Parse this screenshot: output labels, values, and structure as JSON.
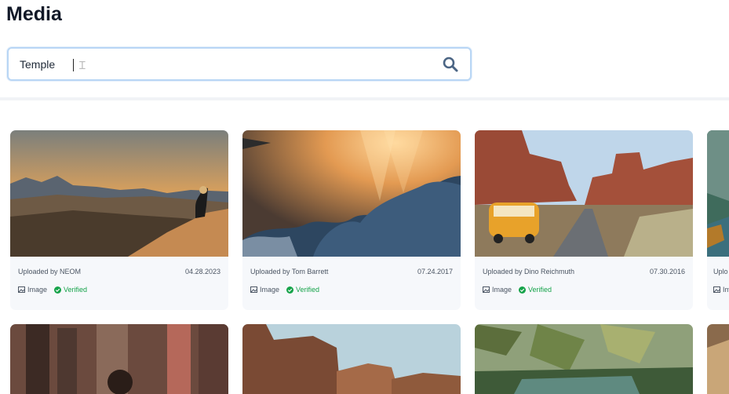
{
  "page": {
    "title": "Media"
  },
  "search": {
    "value": "Temple",
    "placeholder": ""
  },
  "cards": [
    {
      "uploader": "Uploaded by NEOM",
      "date": "04.28.2023",
      "type": "Image",
      "status": "Verified"
    },
    {
      "uploader": "Uploaded by Tom Barrett",
      "date": "07.24.2017",
      "type": "Image",
      "status": "Verified"
    },
    {
      "uploader": "Uploaded by Dino Reichmuth",
      "date": "07.30.2016",
      "type": "Image",
      "status": "Verified"
    },
    {
      "uploader": "Uplo",
      "date": "",
      "type": "Im",
      "status": ""
    }
  ],
  "colors": {
    "accent": "#b9d6f5",
    "verified": "#16a34a",
    "search_icon": "#4b6584"
  }
}
